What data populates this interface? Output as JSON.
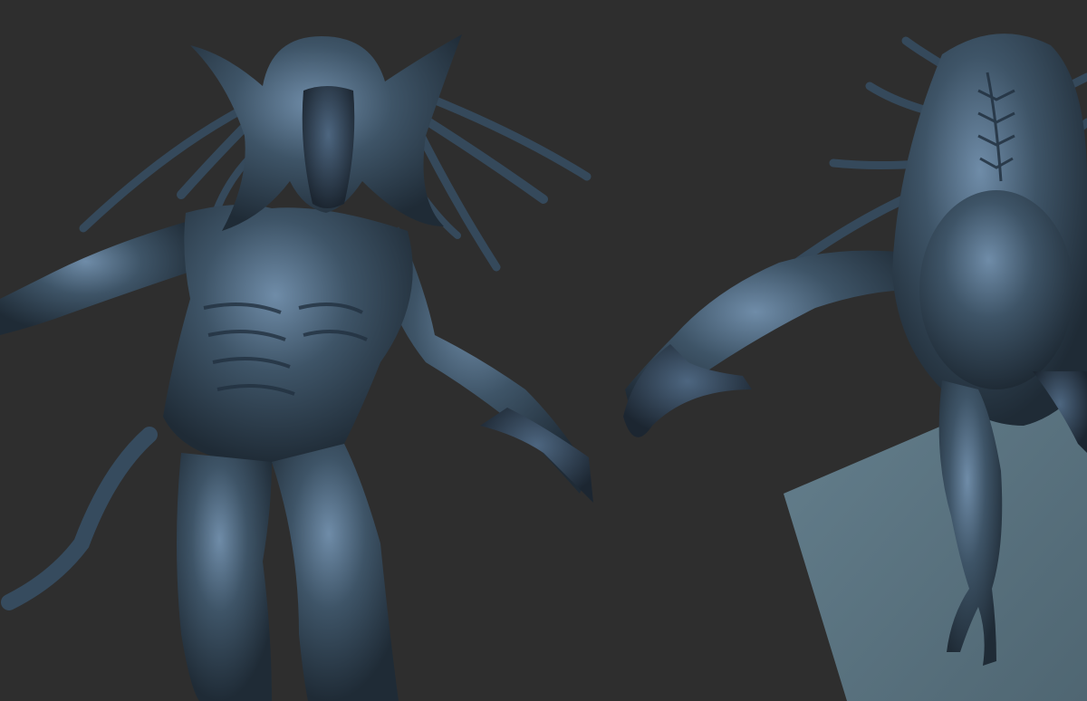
{
  "scene": {
    "background_color": "#2e2e2e",
    "base_platform_color": "#5d7480",
    "sculpt_shadow_color": "#1f2b36",
    "sculpt_mid_color": "#3e5467",
    "sculpt_highlight_color": "#6f8ca8",
    "views": [
      {
        "name": "front-view",
        "subject": "alien-creature-sculpt"
      },
      {
        "name": "top-view",
        "subject": "alien-creature-sculpt"
      }
    ]
  }
}
